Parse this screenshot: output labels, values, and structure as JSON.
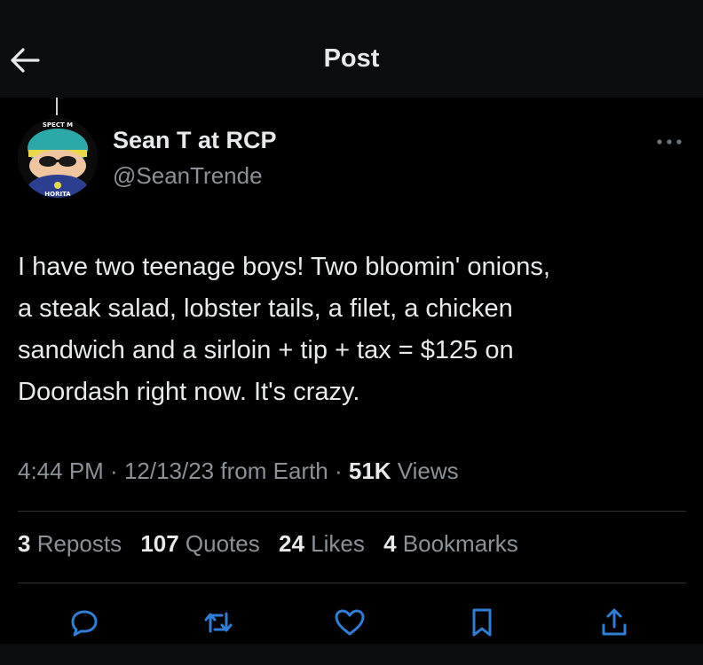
{
  "header": {
    "back_icon": "arrow-left-icon",
    "title": "Post"
  },
  "author": {
    "display_name": "Sean T at RCP",
    "handle": "@SeanTrende",
    "avatar_text_top": "SPECT M",
    "avatar_text_bottom": "HORITA",
    "more_icon": "more-horizontal-icon"
  },
  "post": {
    "text": "I have two teenage boys!  Two bloomin' onions,\na steak salad, lobster tails, a filet, a chicken\nsandwich and a sirloin + tip + tax = $125 on\nDoordash right now.  It's crazy."
  },
  "meta": {
    "time": "4:44 PM",
    "sep1": " · ",
    "date": "12/13/23",
    "source": " from Earth",
    "sep2": " · ",
    "views_count": "51K",
    "views_label": " Views"
  },
  "stats": {
    "reposts": {
      "count": "3",
      "label": " Reposts"
    },
    "quotes": {
      "count": "107",
      "label": " Quotes"
    },
    "likes": {
      "count": "24",
      "label": " Likes"
    },
    "bookmarks": {
      "count": "4",
      "label": " Bookmarks"
    }
  },
  "actions": {
    "reply_icon": "reply-icon",
    "repost_icon": "repost-icon",
    "like_icon": "heart-icon",
    "bookmark_icon": "bookmark-icon",
    "share_icon": "share-icon"
  },
  "colors": {
    "background": "#000000",
    "header_background": "#0b0c0d",
    "text_primary": "#e7e9ea",
    "text_secondary": "#8b9197",
    "divider": "#2f3336",
    "action_icon": "#2f7dd4"
  }
}
